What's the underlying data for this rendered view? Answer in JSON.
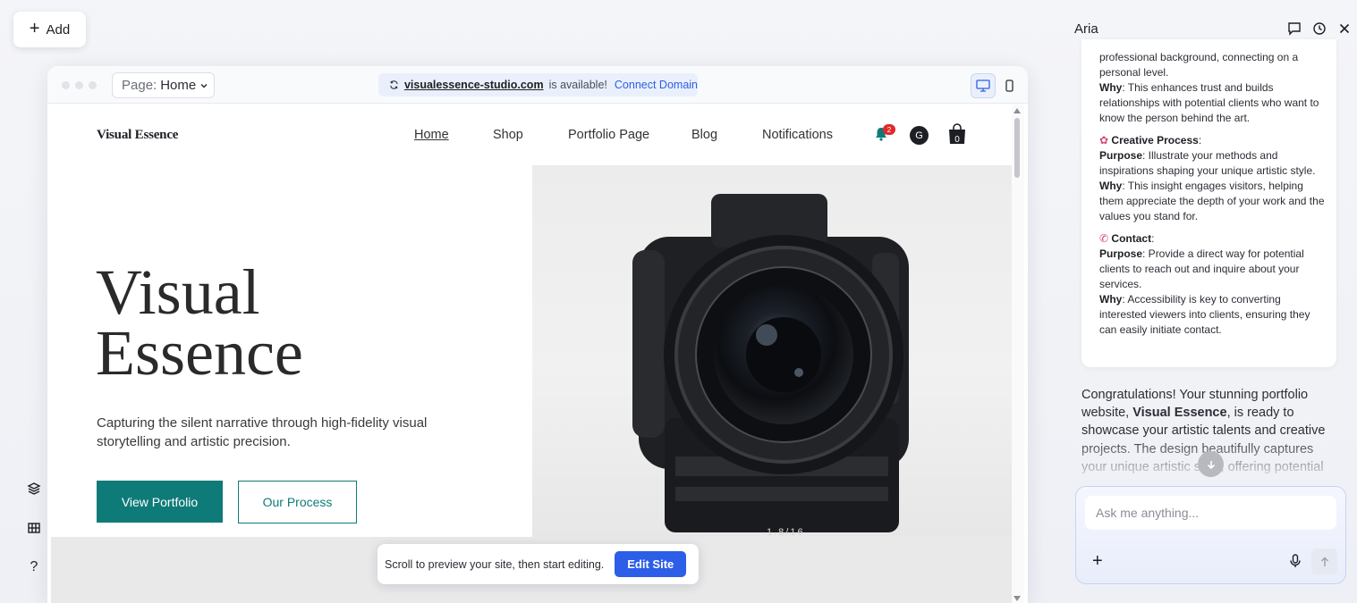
{
  "toolbar": {
    "add_label": "Add"
  },
  "left_rail": {
    "layers_icon": "layers-icon",
    "grid_icon": "grid-icon",
    "help_label": "?"
  },
  "editor": {
    "page_select": {
      "prefix": "Page:",
      "value": "Home"
    },
    "domain_bar": {
      "domain": "visualessence-studio.com",
      "status": "is available!",
      "connect_label": "Connect Domain"
    }
  },
  "site": {
    "logo": "Visual Essence",
    "nav": [
      "Home",
      "Shop",
      "Portfolio Page",
      "Blog",
      "Notifications"
    ],
    "notification_count": "2",
    "avatar_letter": "G",
    "cart_count": "0",
    "hero_title_line1": "Visual",
    "hero_title_line2": "Essence",
    "hero_subtitle": "Capturing the silent narrative through high-fidelity visual storytelling and artistic precision.",
    "primary_button": "View Portfolio",
    "secondary_button": "Our Process",
    "camera_label": "1.8/16",
    "accent_color": "#0f7b78"
  },
  "toast": {
    "message": "Scroll to preview your site, then start editing.",
    "button": "Edit Site"
  },
  "aria": {
    "title": "Aria",
    "card": {
      "about_tail": "professional background, connecting on a personal level.",
      "about_why_label": "Why",
      "about_why": ": This enhances trust and builds relationships with potential clients who want to know the person behind the art.",
      "creative_title": "Creative Process",
      "creative_purpose_label": "Purpose",
      "creative_purpose": ": Illustrate your methods and inspirations shaping your unique artistic style.",
      "creative_why_label": "Why",
      "creative_why": ": This insight engages visitors, helping them appreciate the depth of your work and the values you stand for.",
      "contact_title": "Contact",
      "contact_purpose_label": "Purpose",
      "contact_purpose": ": Provide a direct way for potential clients to reach out and inquire about your services.",
      "contact_why_label": "Why",
      "contact_why": ": Accessibility is key to converting interested viewers into clients, ensuring they can easily initiate contact."
    },
    "congrats_pre": "Congratulations! Your stunning portfolio website, ",
    "congrats_bold": "Visual Essence",
    "congrats_post": ", is ready to showcase your artistic talents and creative projects. The design beautifully captures your unique artistic style, offering potential",
    "input_placeholder": "Ask me anything..."
  }
}
